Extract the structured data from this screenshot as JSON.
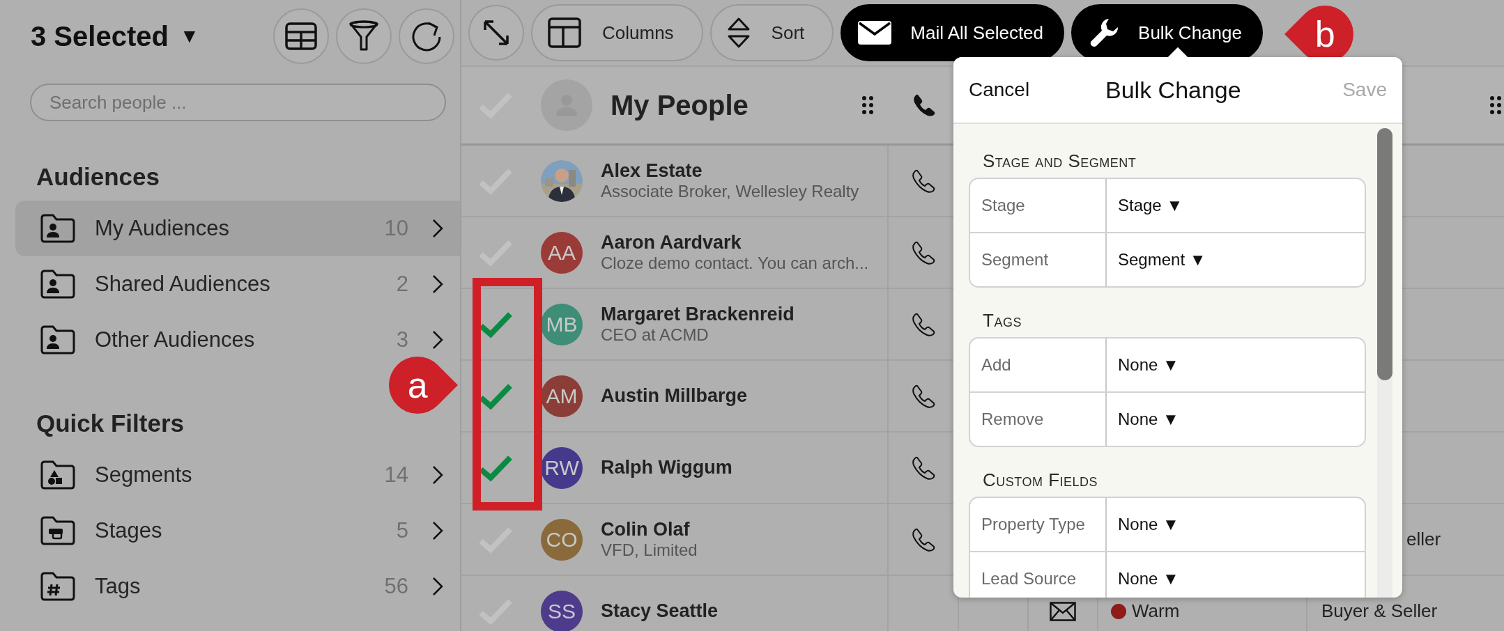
{
  "sidebar": {
    "title": "3 Selected",
    "title_caret": "▼",
    "search": {
      "placeholder": "Search people ..."
    },
    "sections": [
      {
        "heading": "Audiences",
        "items": [
          {
            "label": "My Audiences",
            "count": "10",
            "selected": true
          },
          {
            "label": "Shared Audiences",
            "count": "2",
            "selected": false
          },
          {
            "label": "Other Audiences",
            "count": "3",
            "selected": false
          }
        ]
      },
      {
        "heading": "Quick Filters",
        "items": [
          {
            "label": "Segments",
            "count": "14",
            "selected": false
          },
          {
            "label": "Stages",
            "count": "5",
            "selected": false
          },
          {
            "label": "Tags",
            "count": "56",
            "selected": false
          }
        ]
      }
    ]
  },
  "toolbar": {
    "buttons": [
      {
        "kind": "icon"
      },
      {
        "kind": "pill",
        "label": "Columns"
      },
      {
        "kind": "pill",
        "label": "Sort"
      },
      {
        "kind": "dark",
        "label": "Mail All Selected"
      },
      {
        "kind": "dark",
        "label": "Bulk Change"
      }
    ]
  },
  "list": {
    "title": "My People",
    "rows": [
      {
        "name": "Alex Estate",
        "subtitle": "Associate Broker, Wellesley Realty",
        "selected": false,
        "phone": true
      },
      {
        "name": "Aaron Aardvark",
        "subtitle": "Cloze demo contact. You can arch...",
        "initials": "AA",
        "color": "#9a3b37",
        "selected": false,
        "phone": true
      },
      {
        "name": "Margaret Brackenreid",
        "subtitle": "CEO at ACMD",
        "initials": "MB",
        "color": "#3e8d77",
        "selected": true,
        "phone": true
      },
      {
        "name": "Austin Millbarge",
        "initials": "AM",
        "color": "#8b3d37",
        "selected": true,
        "phone": true
      },
      {
        "name": "Ralph Wiggum",
        "initials": "RW",
        "color": "#45398b",
        "selected": true,
        "phone": true
      },
      {
        "name": "Colin Olaf",
        "subtitle": "VFD, Limited",
        "initials": "CO",
        "color": "#8a6a3b",
        "selected": false,
        "phone": true,
        "type": "eller"
      },
      {
        "name": "Stacy Seattle",
        "initials": "SS",
        "color": "#4e3b8b",
        "selected": false,
        "phone": false,
        "mail": true,
        "status": {
          "label": "Warm",
          "color": "#8f1b1b"
        },
        "type": "Buyer & Seller"
      }
    ]
  },
  "popover": {
    "cancel": "Cancel",
    "title": "Bulk Change",
    "save": "Save",
    "save_disabled": true,
    "sections": [
      {
        "heading": "Stage and Segment",
        "fields": [
          {
            "label": "Stage",
            "value": "Stage ▼"
          },
          {
            "label": "Segment",
            "value": "Segment ▼"
          }
        ]
      },
      {
        "heading": "Tags",
        "fields": [
          {
            "label": "Add",
            "value": "None ▼"
          },
          {
            "label": "Remove",
            "value": "None ▼"
          }
        ]
      },
      {
        "heading": "Custom Fields",
        "fields": [
          {
            "label": "Property Type",
            "value": "None ▼"
          },
          {
            "label": "Lead Source",
            "value": "None ▼"
          }
        ]
      }
    ]
  },
  "annotations": [
    {
      "label": "a"
    },
    {
      "label": "b"
    }
  ]
}
